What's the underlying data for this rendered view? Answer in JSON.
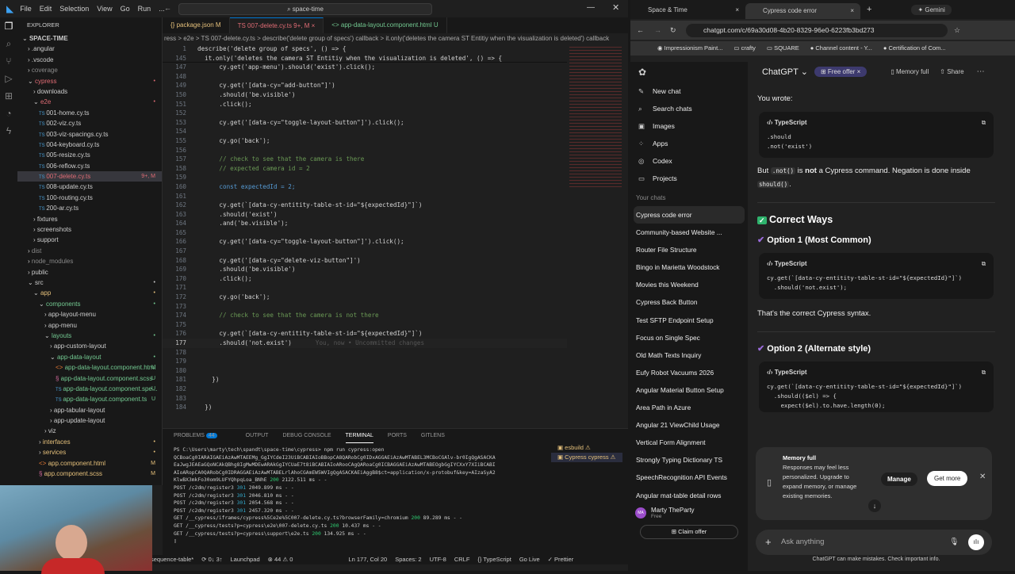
{
  "vscode": {
    "menu": [
      "File",
      "Edit",
      "Selection",
      "View",
      "Go",
      "Run",
      "..."
    ],
    "search": "space-time",
    "explorer_title": "EXPLORER",
    "explorer": [
      {
        "d": 0,
        "t": "open",
        "n": "SPACE-TIME",
        "c": "#ccc",
        "b": ""
      },
      {
        "d": 1,
        "t": "closed",
        "n": ".angular",
        "c": "#ccc",
        "b": ""
      },
      {
        "d": 1,
        "t": "closed",
        "n": ".vscode",
        "c": "#ccc",
        "b": ""
      },
      {
        "d": 1,
        "t": "closed",
        "n": "coverage",
        "c": "#888",
        "b": ""
      },
      {
        "d": 1,
        "t": "open",
        "n": "cypress",
        "c": "#e06c75",
        "b": "•"
      },
      {
        "d": 2,
        "t": "closed",
        "n": "downloads",
        "c": "#ccc",
        "b": ""
      },
      {
        "d": 2,
        "t": "open",
        "n": "e2e",
        "c": "#e06c75",
        "b": "•"
      },
      {
        "d": 3,
        "t": "ts",
        "n": "001-home.cy.ts",
        "c": "#ccc",
        "b": ""
      },
      {
        "d": 3,
        "t": "ts",
        "n": "002-viz.cy.ts",
        "c": "#ccc",
        "b": ""
      },
      {
        "d": 3,
        "t": "ts",
        "n": "003-viz-spacings.cy.ts",
        "c": "#ccc",
        "b": ""
      },
      {
        "d": 3,
        "t": "ts",
        "n": "004-keyboard.cy.ts",
        "c": "#ccc",
        "b": ""
      },
      {
        "d": 3,
        "t": "ts",
        "n": "005-resize.cy.ts",
        "c": "#ccc",
        "b": ""
      },
      {
        "d": 3,
        "t": "ts",
        "n": "006-reflow.cy.ts",
        "c": "#ccc",
        "b": ""
      },
      {
        "d": 3,
        "t": "ts",
        "n": "007-delete.cy.ts",
        "c": "#e06c75",
        "b": "9+, M",
        "sel": true
      },
      {
        "d": 3,
        "t": "ts",
        "n": "008-update.cy.ts",
        "c": "#ccc",
        "b": ""
      },
      {
        "d": 3,
        "t": "ts",
        "n": "100-routing.cy.ts",
        "c": "#ccc",
        "b": ""
      },
      {
        "d": 3,
        "t": "ts",
        "n": "200-ar.cy.ts",
        "c": "#ccc",
        "b": ""
      },
      {
        "d": 2,
        "t": "closed",
        "n": "fixtures",
        "c": "#ccc",
        "b": ""
      },
      {
        "d": 2,
        "t": "closed",
        "n": "screenshots",
        "c": "#ccc",
        "b": ""
      },
      {
        "d": 2,
        "t": "closed",
        "n": "support",
        "c": "#ccc",
        "b": ""
      },
      {
        "d": 1,
        "t": "closed",
        "n": "dist",
        "c": "#888",
        "b": ""
      },
      {
        "d": 1,
        "t": "closed",
        "n": "node_modules",
        "c": "#888",
        "b": ""
      },
      {
        "d": 1,
        "t": "closed",
        "n": "public",
        "c": "#ccc",
        "b": ""
      },
      {
        "d": 1,
        "t": "open",
        "n": "src",
        "c": "#ccc",
        "b": "•"
      },
      {
        "d": 2,
        "t": "open",
        "n": "app",
        "c": "#e5c07b",
        "b": "•"
      },
      {
        "d": 3,
        "t": "open",
        "n": "components",
        "c": "#73c991",
        "b": "•"
      },
      {
        "d": 4,
        "t": "closed",
        "n": "app-layout-menu",
        "c": "#ccc",
        "b": ""
      },
      {
        "d": 4,
        "t": "closed",
        "n": "app-menu",
        "c": "#ccc",
        "b": ""
      },
      {
        "d": 4,
        "t": "open",
        "n": "layouts",
        "c": "#73c991",
        "b": "•"
      },
      {
        "d": 5,
        "t": "closed",
        "n": "app-custom-layout",
        "c": "#ccc",
        "b": ""
      },
      {
        "d": 5,
        "t": "open",
        "n": "app-data-layout",
        "c": "#73c991",
        "b": "•"
      },
      {
        "d": 6,
        "t": "html",
        "n": "app-data-layout.component.html",
        "c": "#73c991",
        "b": "U"
      },
      {
        "d": 6,
        "t": "scss",
        "n": "app-data-layout.component.scss",
        "c": "#73c991",
        "b": "U"
      },
      {
        "d": 6,
        "t": "ts",
        "n": "app-data-layout.component.spe...",
        "c": "#73c991",
        "b": "U"
      },
      {
        "d": 6,
        "t": "ts",
        "n": "app-data-layout.component.ts",
        "c": "#73c991",
        "b": "U"
      },
      {
        "d": 5,
        "t": "closed",
        "n": "app-tabular-layout",
        "c": "#ccc",
        "b": ""
      },
      {
        "d": 5,
        "t": "closed",
        "n": "app-update-layout",
        "c": "#ccc",
        "b": ""
      },
      {
        "d": 4,
        "t": "closed",
        "n": "viz",
        "c": "#ccc",
        "b": ""
      },
      {
        "d": 3,
        "t": "closed",
        "n": "interfaces",
        "c": "#e5c07b",
        "b": "•"
      },
      {
        "d": 3,
        "t": "closed",
        "n": "services",
        "c": "#e5c07b",
        "b": "•"
      },
      {
        "d": 3,
        "t": "html",
        "n": "app.component.html",
        "c": "#e5c07b",
        "b": "M"
      },
      {
        "d": 3,
        "t": "scss",
        "n": "app.component.scss",
        "c": "#e5c07b",
        "b": "M"
      }
    ],
    "tabs": [
      {
        "label": "{} package.json M",
        "color": "#e5c07b"
      },
      {
        "label": "TS 007-delete.cy.ts 9+, M ×",
        "color": "#e06c75",
        "active": true
      },
      {
        "label": "<> app-data-layout.component.html U",
        "color": "#73c991"
      }
    ],
    "breadcrumb": "ress > e2e > TS 007-delete.cy.ts > describe('delete group of specs') callback > it.only('deletes the camera ST Entitiy when the visualization is deleted') callback",
    "code": [
      [
        "1",
        "describe('delete group of specs', () => {",
        "tx"
      ],
      [
        "145",
        "  it.only('deletes the camera ST Entitiy when the visualization is deleted', () => {",
        "tx"
      ],
      [
        "147",
        "      cy.get('app-menu').should('exist').click();",
        "tx"
      ],
      [
        "148",
        "",
        "tx"
      ],
      [
        "149",
        "      cy.get('[data-cy=\"add-button\"]')",
        "tx"
      ],
      [
        "150",
        "      .should('be.visible')",
        "tx"
      ],
      [
        "151",
        "      .click();",
        "tx"
      ],
      [
        "152",
        "",
        "tx"
      ],
      [
        "153",
        "      cy.get('[data-cy=\"toggle-layout-button\"]').click();",
        "tx"
      ],
      [
        "154",
        "",
        "tx"
      ],
      [
        "155",
        "      cy.go('back');",
        "tx"
      ],
      [
        "156",
        "",
        "tx"
      ],
      [
        "157",
        "      // check to see that the camera is there",
        "cm"
      ],
      [
        "158",
        "      // expected camera id = 2",
        "cm"
      ],
      [
        "159",
        "",
        "tx"
      ],
      [
        "160",
        "      const expectedId = 2;",
        "kw"
      ],
      [
        "161",
        "",
        "tx"
      ],
      [
        "162",
        "      cy.get(`[data-cy-entitity-table-st-id=\"${expectedId}\"]`)",
        "tx"
      ],
      [
        "163",
        "      .should('exist')",
        "tx"
      ],
      [
        "164",
        "      .and('be.visible');",
        "tx"
      ],
      [
        "165",
        "",
        "tx"
      ],
      [
        "166",
        "      cy.get('[data-cy=\"toggle-layout-button\"]').click();",
        "tx"
      ],
      [
        "167",
        "",
        "tx"
      ],
      [
        "168",
        "      cy.get('[data-cy=\"delete-viz-button\"]')",
        "tx"
      ],
      [
        "169",
        "      .should('be.visible')",
        "tx"
      ],
      [
        "170",
        "      .click();",
        "tx"
      ],
      [
        "171",
        "",
        "tx"
      ],
      [
        "172",
        "      cy.go('back');",
        "tx"
      ],
      [
        "173",
        "",
        "tx"
      ],
      [
        "174",
        "      // check to see that the camera is not there",
        "cm"
      ],
      [
        "175",
        "",
        "tx"
      ],
      [
        "176",
        "      cy.get(`[data-cy-entitity-table-st-id=\"${expectedId}\"]`)",
        "tx"
      ],
      [
        "177",
        "      .should('not.exist')",
        "cur"
      ],
      [
        "178",
        "",
        "tx"
      ],
      [
        "179",
        "",
        "tx"
      ],
      [
        "180",
        "",
        "tx"
      ],
      [
        "181",
        "    })",
        "tx"
      ],
      [
        "182",
        "",
        "tx"
      ],
      [
        "183",
        "",
        "tx"
      ],
      [
        "184",
        "  })",
        "tx"
      ]
    ],
    "blame": "You, now • Uncommitted changes",
    "panel_tabs": [
      "PROBLEMS",
      "OUTPUT",
      "DEBUG CONSOLE",
      "TERMINAL",
      "PORTS",
      "GITLENS"
    ],
    "problems_count": "44",
    "terminal": [
      "PS C:\\Users\\marty\\tech\\spandt\\space-time\\cypress> npm run cypress:open",
      "QCBoaCg0IARAIGAEiAzAwMTAEEMg_GgIYCdeI23UiBCABIAIoBBopCA8QARobCg0IDxAGGAEiAzAwMTABEL3MCBoCGAlv-br0IgQgASACKA",
      "EaJwgJEAEaGQoNCAkQBhg8IgMwMDEwARAkGgIYCUaE7t8iBCABIAIoARooCAgQARoaCg0ICBAGGAEiAzAwMTABEOgbGgIYCXxY7XIiBCABI",
      "AIoARopCA0QARobCg0IDRAGGAEiAzAwMTABELrlAhoCGAmEW5WVIgQgASACKAEiAggB8$ct=application/x-protobuf&key=AIzaSyA2",
      "KlwBX3mkFo30om9LUFYQhpqLoa_BNhE 200 2122.511 ms - -",
      "POST /c2dm/register3 301 2049.899 ms - -",
      "POST /c2dm/register3 301 2046.810 ms - -",
      "POST /c2dm/register3 301 2054.568 ms - -",
      "POST /c2dm/register3 301 2457.320 ms - -",
      "GET /__cypress/iframes/cypress%5Ce2e%5C007-delete.cy.ts?browserFamily=chromium 200 89.289 ms - -",
      "GET /__cypress/tests?p=cypress\\e2e\\007-delete.cy.ts 200 10.437 ms - -",
      "GET /__cypress/tests?p=cypress\\support\\e2e.ts 200 134.925 ms - -",
      "▯"
    ],
    "terminals": [
      "esbuild",
      "Cypress  cypress"
    ],
    "status": [
      "sequence-table*",
      "⟳ 0↓ 3↑",
      "Launchpad",
      "⊗ 44 ⚠ 0",
      "Ln 177, Col 20",
      "Spaces: 2",
      "UTF-8",
      "CRLF",
      "{} TypeScript",
      "Go Live",
      "✓ Prettier"
    ]
  },
  "browser": {
    "tabs": [
      "Space & Time",
      "Cypress code error",
      "Gemini"
    ],
    "url": "chatgpt.com/c/69a30d08-4b20-8329-96e0-6223fb3bd273",
    "bookmarks": [
      "Impressionism Paint...",
      "crafty",
      "SQUARE",
      "Channel content - Y...",
      "Certification of Com..."
    ]
  },
  "chatgpt": {
    "title": "ChatGPT",
    "free_offer": "Free offer",
    "memory_full": "Memory full",
    "share": "Share",
    "nav": [
      {
        "icon": "✎",
        "label": "New chat"
      },
      {
        "icon": "⌕",
        "label": "Search chats"
      },
      {
        "icon": "▣",
        "label": "Images"
      },
      {
        "icon": "⁘",
        "label": "Apps"
      },
      {
        "icon": "◎",
        "label": "Codex"
      },
      {
        "icon": "▭",
        "label": "Projects"
      }
    ],
    "your_chats": "Your chats",
    "chats": [
      "Cypress code error",
      "Community-based Website ...",
      "Router File Structure",
      "Bingo in Marietta Woodstock",
      "Movies this Weekend",
      "Cypress Back Button",
      "Test SFTP Endpoint Setup",
      "Focus on Single Spec",
      "Old Math Texts Inquiry",
      "Eufy Robot Vacuums 2026",
      "Angular Material Button Setup",
      "Area Path in Azure",
      "Angular 21 ViewChild Usage",
      "Vertical Form Alignment",
      "Strongly Typing Dictionary TS",
      "SpeechRecognition API Events",
      "Angular mat-table detail rows"
    ],
    "user": {
      "initials": "MA",
      "name": "Marty TheParty",
      "plan": "Free"
    },
    "claim": "Claim offer",
    "msg": {
      "you_wrote": "You wrote:",
      "lang": "TypeScript",
      "code1": ".should\n.not('exist')",
      "but": "But",
      "not_cmd": ".not()",
      "is": "is",
      "not_bold": "not",
      "rest": "a Cypress command. Negation is done inside",
      "should_cmd": "should()",
      "correct": "Correct Ways",
      "opt1": "Option 1 (Most Common)",
      "code2": "cy.get(`[data-cy-entitity-table-st-id=\"${expectedId}\"]`)\n  .should('not.exist');",
      "thats": "That's the correct Cypress syntax.",
      "opt2": "Option 2 (Alternate style)",
      "code3": "cy.get(`[data-cy-entitity-table-st-id=\"${expectedId}\"]`)\n  .should(($el) => {\n    expect($el).to.have.length(0);\n  });"
    },
    "memory_card": {
      "title": "Memory full",
      "body": "Responses may feel less personalized. Upgrade to expand memory, or manage existing memories.",
      "manage": "Manage",
      "get_more": "Get more"
    },
    "input_placeholder": "Ask anything",
    "disclaimer": "ChatGPT can make mistakes. Check important info."
  }
}
